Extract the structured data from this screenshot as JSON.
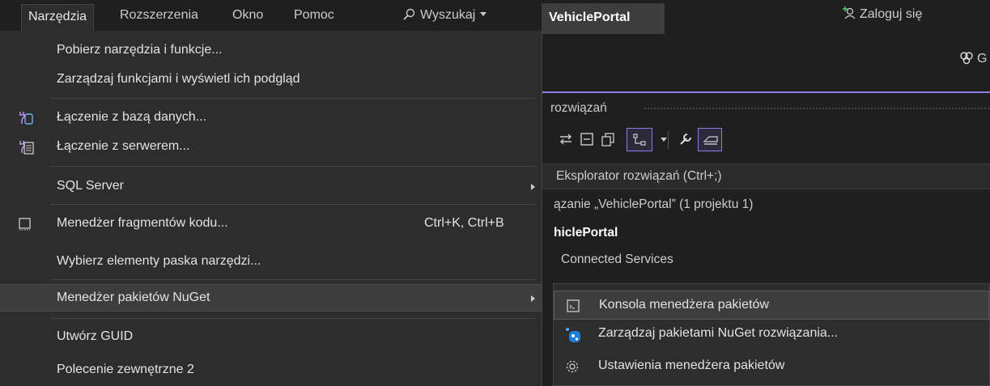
{
  "menubar": {
    "items": [
      {
        "label": "Narzędzia"
      },
      {
        "label": "Rozszerzenia"
      },
      {
        "label": "Okno"
      },
      {
        "label": "Pomoc"
      }
    ],
    "search_label": "Wyszukaj",
    "solution_name": "VehiclePortal",
    "login_label": "Zaloguj się"
  },
  "toolbar": {
    "copilot_label": "G"
  },
  "explorer": {
    "title": "rozwiązań",
    "search_placeholder": "Eksplorator rozwiązań (Ctrl+;)",
    "tree": [
      "ązanie „VehiclePortal” (1 projektu 1)",
      "hiclePortal",
      "Connected Services"
    ]
  },
  "dropdown": {
    "items": [
      {
        "label": "Pobierz narzędzia i funkcje..."
      },
      {
        "label": "Zarządzaj funkcjami i wyświetl ich podgląd"
      },
      {
        "label": "Łączenie z bazą danych..."
      },
      {
        "label": "Łączenie z serwerem..."
      },
      {
        "label": "SQL Server"
      },
      {
        "label": "Menedżer fragmentów kodu...",
        "shortcut": "Ctrl+K, Ctrl+B"
      },
      {
        "label": "Wybierz elementy paska narzędzi..."
      },
      {
        "label": "Menedżer pakietów NuGet"
      },
      {
        "label": "Utwórz GUID"
      },
      {
        "label": "Polecenie zewnętrzne 2"
      }
    ]
  },
  "submenu": {
    "items": [
      {
        "label": "Konsola menedżera pakietów"
      },
      {
        "label": "Zarządzaj pakietami NuGet rozwiązania..."
      },
      {
        "label": "Ustawienia menedżera pakietów"
      }
    ]
  },
  "colors": {
    "accent": "#8c7ae6",
    "menu_bg": "#2d2d2d",
    "highlight": "#3d3d3d"
  }
}
